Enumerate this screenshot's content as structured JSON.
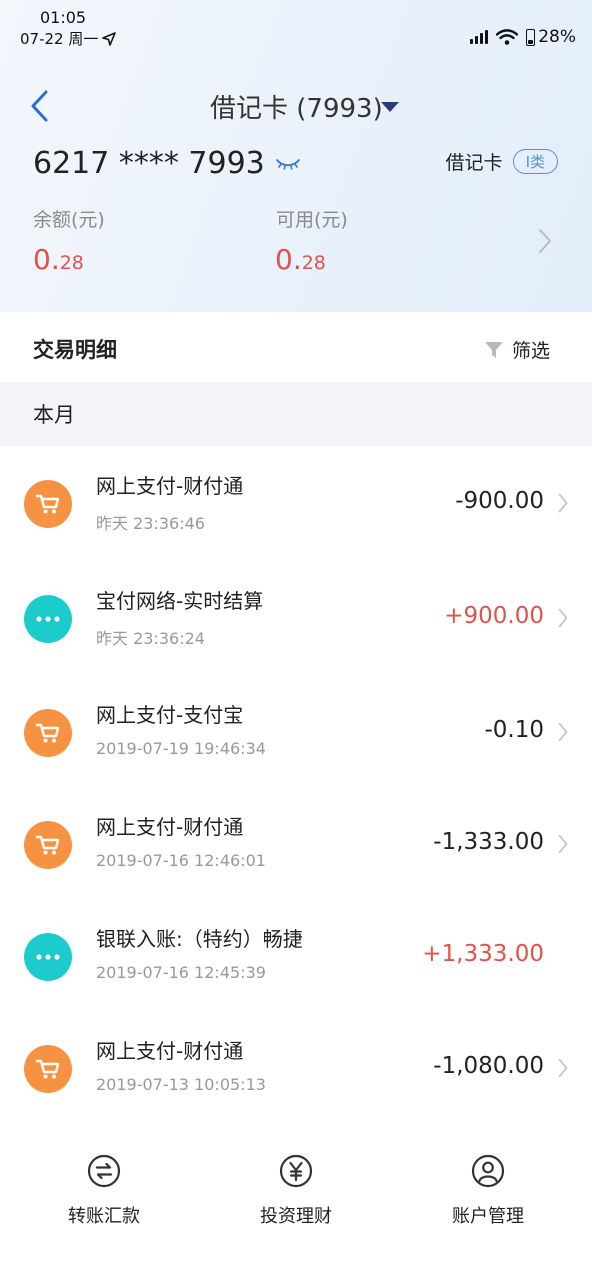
{
  "status_bar": {
    "time": "01:05",
    "date": "07-22 周一",
    "battery": "28%"
  },
  "header": {
    "title": "借记卡 (7993)",
    "card_number": "6217 **** 7993",
    "card_type": "借记卡",
    "card_class": "I类",
    "balance_label": "余额(元)",
    "balance_int": "0.",
    "balance_dec": "28",
    "available_label": "可用(元)",
    "available_int": "0.",
    "available_dec": "28"
  },
  "section": {
    "title": "交易明细",
    "filter_label": "筛选"
  },
  "month": {
    "label": "本月"
  },
  "transactions": [
    {
      "name": "网上支付-财付通",
      "time": "昨天  23:36:46",
      "amount": "-900.00",
      "type": "cart"
    },
    {
      "name": "宝付网络-实时结算",
      "time": "昨天  23:36:24",
      "amount": "+900.00",
      "type": "dots"
    },
    {
      "name": "网上支付-支付宝",
      "time": "2019-07-19  19:46:34",
      "amount": "-0.10",
      "type": "cart"
    },
    {
      "name": "网上支付-财付通",
      "time": "2019-07-16  12:46:01",
      "amount": "-1,333.00",
      "type": "cart"
    },
    {
      "name": "银联入账:（特约）畅捷",
      "time": "2019-07-16  12:45:39",
      "amount": "+1,333.00",
      "type": "dots"
    },
    {
      "name": "网上支付-财付通",
      "time": "2019-07-13  10:05:13",
      "amount": "-1,080.00",
      "type": "cart"
    }
  ],
  "bottom_nav": {
    "transfer": "转账汇款",
    "invest": "投资理财",
    "account": "账户管理"
  },
  "colors": {
    "accent_blue": "#2a6fd6",
    "negative_red": "#e2524c",
    "orange_icon": "#f79242",
    "teal_icon": "#1ccccc"
  }
}
